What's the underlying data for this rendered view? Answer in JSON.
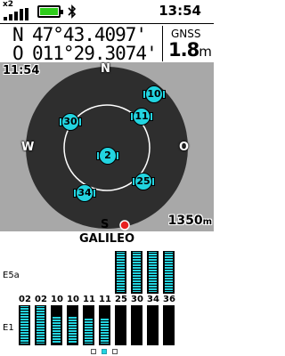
{
  "status_bar": {
    "sat_multiplier": "x2",
    "signal_icon": "signal-strength-icon",
    "battery_icon": "battery-full-icon",
    "bluetooth_icon": "bluetooth-icon",
    "time": "13:54"
  },
  "position": {
    "lat_hemisphere": "N",
    "lat_value": "47°43.4097'",
    "lon_hemisphere": "O",
    "lon_value": "011°29.3074'",
    "source_label": "GNSS",
    "accuracy_value": "1.8",
    "accuracy_unit": "m"
  },
  "sky_view": {
    "time": "11:54",
    "compass": {
      "north": "N",
      "east": "O",
      "south": "S",
      "west": "W"
    },
    "scale_value": "1350",
    "scale_unit": "m",
    "satellite_color": "#22d4e0",
    "background_color": "#a8a8a8",
    "satellites": [
      {
        "id": "10"
      },
      {
        "id": "11"
      },
      {
        "id": "30"
      },
      {
        "id": "2"
      },
      {
        "id": "25"
      },
      {
        "id": "34"
      }
    ]
  },
  "signal_panel": {
    "constellation": "GALILEO",
    "band_e5a": "E5a",
    "band_e1": "E1",
    "satellites": [
      {
        "id": "02",
        "e1": 1.0,
        "e5a": null
      },
      {
        "id": "02",
        "e1": 1.0,
        "e5a": null
      },
      {
        "id": "10",
        "e1": 0.7,
        "e5a": null
      },
      {
        "id": "10",
        "e1": 0.7,
        "e5a": null
      },
      {
        "id": "11",
        "e1": 0.65,
        "e5a": null
      },
      {
        "id": "11",
        "e1": 0.65,
        "e5a": null
      },
      {
        "id": "25",
        "e1": 0.0,
        "e5a": 1.0
      },
      {
        "id": "30",
        "e1": 0.0,
        "e5a": 1.0
      },
      {
        "id": "34",
        "e1": 0.0,
        "e5a": 1.0
      },
      {
        "id": "36",
        "e1": 0.0,
        "e5a": 1.0
      }
    ]
  },
  "pager": {
    "pages": 3,
    "active_page": 2
  }
}
